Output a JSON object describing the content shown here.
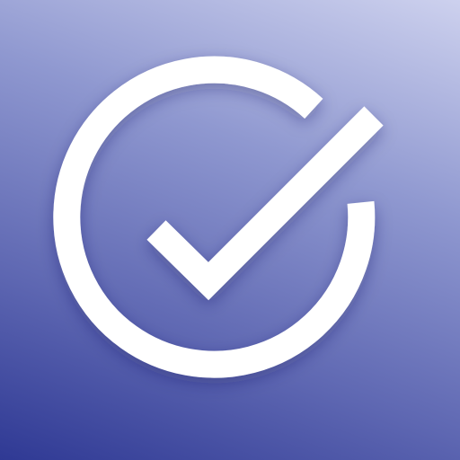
{
  "icon": {
    "glyph": "check-circle-icon",
    "colors": {
      "gradient_light": "#cdd1ee",
      "gradient_mid_light": "#8f98d0",
      "gradient_mid_dark": "#5e67b2",
      "gradient_dark": "#2f3994",
      "glyph": "#ffffff"
    }
  }
}
